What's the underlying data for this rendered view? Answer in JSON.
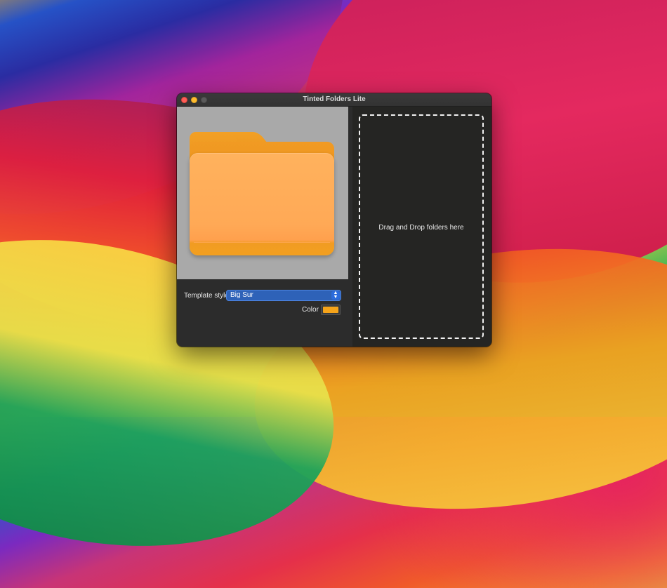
{
  "window": {
    "title": "Tinted Folders Lite"
  },
  "controls": {
    "template_style_label": "Template style",
    "template_style_value": "Big Sur",
    "color_label": "Color",
    "color_value": "#f6a41a"
  },
  "drop_zone": {
    "text": "Drag and Drop folders here"
  },
  "icons": {
    "folder_preview": "folder-icon",
    "select_arrows": "chevron-up-down-icon"
  },
  "colors": {
    "folder_tint": "#ffa956",
    "accent": "#2e62b8"
  }
}
